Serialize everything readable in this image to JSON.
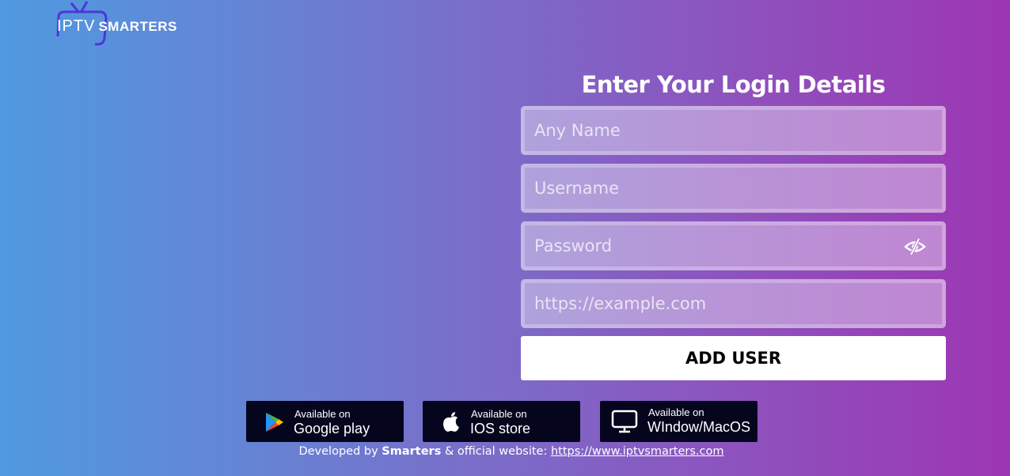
{
  "brand": {
    "logo_part1": "IPTV",
    "logo_part2": "SMARTERS"
  },
  "login": {
    "title": "Enter Your Login Details",
    "name_placeholder": "Any Name",
    "username_placeholder": "Username",
    "password_placeholder": "Password",
    "url_placeholder": "https://example.com",
    "password_toggle_icon": "eye-slash-icon",
    "submit_label": "ADD USER"
  },
  "stores": [
    {
      "icon": "google-play-icon",
      "small": "Available on",
      "big": "Google play"
    },
    {
      "icon": "apple-icon",
      "small": "Available on",
      "big": "IOS store"
    },
    {
      "icon": "monitor-icon",
      "small": "Available on",
      "big": "WIndow/MacOS"
    }
  ],
  "footer": {
    "prefix": "Developed by",
    "company": "Smarters",
    "middle": "& official website:",
    "link": "https://www.iptvsmarters.com"
  },
  "colors": {
    "gradient_left": "#4f9ae0",
    "gradient_right": "#9c36b3",
    "store_bg": "#05061e"
  }
}
